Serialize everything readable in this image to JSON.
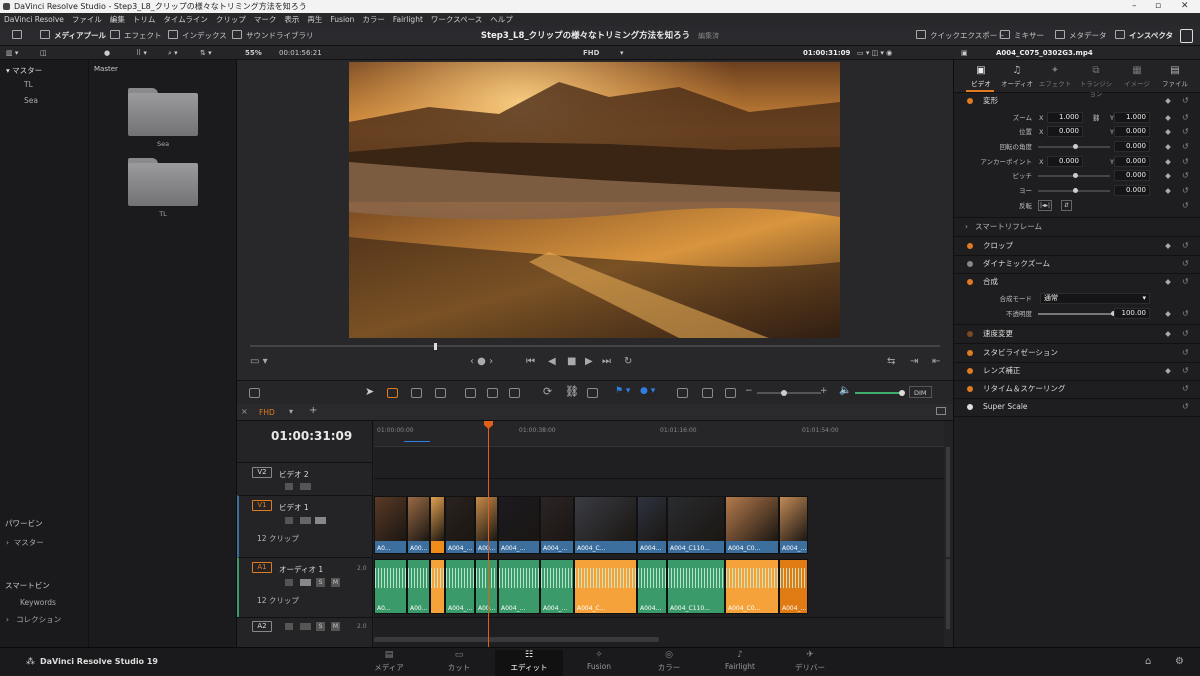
{
  "window": {
    "title": "DaVinci Resolve Studio - Step3_L8_クリップの様々なトリミング方法を知ろう"
  },
  "menu": [
    "DaVinci Resolve",
    "ファイル",
    "編集",
    "トリム",
    "タイムライン",
    "クリップ",
    "マーク",
    "表示",
    "再生",
    "Fusion",
    "カラー",
    "Fairlight",
    "ワークスペース",
    "ヘルプ"
  ],
  "toolbar": {
    "media_pool": "メディアプール",
    "effects": "エフェクト",
    "index": "インデックス",
    "sound_library": "サウンドライブラリ",
    "project_title": "Step3_L8_クリップの様々なトリミング方法を知ろう",
    "status": "編集済み",
    "quick_export": "クイックエクスポート",
    "mixer": "ミキサー",
    "metadata": "メタデータ",
    "inspector": "インスペクタ"
  },
  "subbar": {
    "zoom": "55%",
    "duration": "00:01:56:21",
    "timeline_name": "FHD",
    "timecode": "01:00:31:09",
    "clip_name": "A004_C075_0302G3.mp4"
  },
  "media_pool": {
    "header": "マスター",
    "bins": [
      "TL",
      "Sea"
    ],
    "current": "Master",
    "folders": [
      "Sea",
      "TL"
    ],
    "power_bins": "パワービン",
    "power_master": "マスター",
    "smart_bins": "スマートビン",
    "keywords": "Keywords",
    "collections": "コレクション"
  },
  "timeline": {
    "tab": "FHD",
    "timecode": "01:00:31:09",
    "ruler": [
      "01:00:00:00",
      "01:00:38:00",
      "01:01:16:00",
      "01:01:54:00"
    ],
    "tracks": {
      "v2": {
        "id": "V2",
        "name": "ビデオ 2"
      },
      "v1": {
        "id": "V1",
        "name": "ビデオ 1",
        "count": "12 クリップ"
      },
      "a1": {
        "id": "A1",
        "name": "オーディオ 1",
        "count": "12 クリップ",
        "channels": "2.0"
      },
      "a2": {
        "id": "A2",
        "channels": "2.0"
      }
    },
    "video_clips": [
      "A0...",
      "A00...",
      "",
      "A004_...",
      "A00...",
      "A004_...",
      "A004_...",
      "A004_C...",
      "A004...",
      "A004_C110...",
      "A004_C0...",
      "A004_..."
    ],
    "audio_clips": [
      "A0...",
      "A00...",
      "",
      "A004_...",
      "A00...",
      "A004_...",
      "A004_...",
      "A004_C...",
      "A004...",
      "A004_C110...",
      "A004_C0...",
      "A004_..."
    ],
    "dim": "DIM"
  },
  "inspector": {
    "tabs": [
      "ビデオ",
      "オーディオ",
      "エフェクト",
      "トランジション",
      "イメージ",
      "ファイル"
    ],
    "transform": {
      "title": "変形",
      "zoom_label": "ズーム",
      "zoom_x": "1.000",
      "zoom_y": "1.000",
      "pos_label": "位置",
      "pos_x": "0.000",
      "pos_y": "0.000",
      "rot_label": "回転の角度",
      "rot": "0.000",
      "anchor_label": "アンカーポイント",
      "anchor_x": "0.000",
      "anchor_y": "0.000",
      "pitch_label": "ピッチ",
      "pitch": "0.000",
      "yaw_label": "ヨー",
      "yaw": "0.000",
      "flip_label": "反転"
    },
    "smart_reframe": "スマートリフレーム",
    "crop": "クロップ",
    "dynamic_zoom": "ダイナミックズーム",
    "composite": {
      "title": "合成",
      "mode_label": "合成モード",
      "mode": "通常",
      "opacity_label": "不透明度",
      "opacity": "100.00"
    },
    "speed": "速度変更",
    "stabilization": "スタビライゼーション",
    "lens": "レンズ補正",
    "retime": "リタイム＆スケーリング",
    "superscale": "Super Scale"
  },
  "pages": {
    "brand": "DaVinci Resolve Studio 19",
    "items": [
      "メディア",
      "カット",
      "エディット",
      "Fusion",
      "カラー",
      "Fairlight",
      "デリバー"
    ]
  },
  "colors": {
    "accent": "#e07b22",
    "video_clip": "#3d6f9e",
    "audio_clip": "#3b9a6a",
    "audio_selected": "#f08c1a",
    "playhead": "#e0601a"
  }
}
